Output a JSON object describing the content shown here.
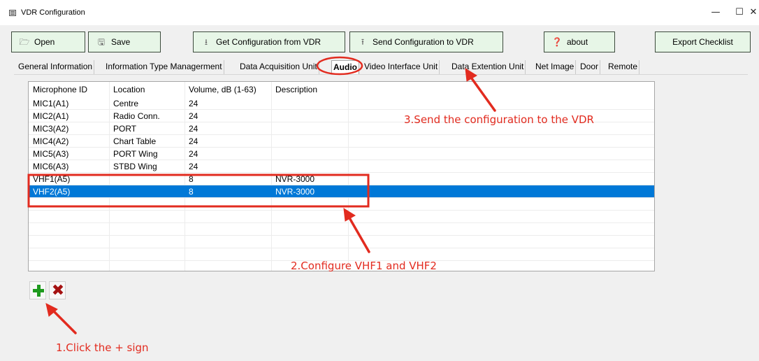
{
  "window": {
    "title": "VDR Configuration",
    "controls": {
      "minimize": "—",
      "maximize": "☐",
      "close": "✕"
    }
  },
  "toolbar": {
    "open_label": "Open",
    "open_icon": "folder-open-icon",
    "save_label": "Save",
    "save_icon": "floppy-disk-icon",
    "get_config_label": "Get Configuration from VDR",
    "get_config_icon": "download-tray-icon",
    "send_config_label": "Send Configuration to VDR",
    "send_config_icon": "upload-tray-icon",
    "about_label": "about",
    "about_icon": "question-circle-icon",
    "export_label": "Export Checklist"
  },
  "tabs": [
    {
      "label": "General Information"
    },
    {
      "label": "Information Type Managerment"
    },
    {
      "label": "Data Acquisition Unit"
    },
    {
      "label": "Audio",
      "active": true
    },
    {
      "label": "Video Interface Unit"
    },
    {
      "label": "Data Extention Unit"
    },
    {
      "label": "Net Image"
    },
    {
      "label": "Door"
    },
    {
      "label": "Remote"
    }
  ],
  "audio_table": {
    "columns": [
      "Microphone ID",
      "Location",
      "Volume, dB (1-63)",
      "Description"
    ],
    "rows": [
      [
        "MIC1(A1)",
        "Centre",
        "24",
        ""
      ],
      [
        "MIC2(A1)",
        "Radio Conn.",
        "24",
        ""
      ],
      [
        "MIC3(A2)",
        "PORT",
        "24",
        ""
      ],
      [
        "MIC4(A2)",
        "Chart Table",
        "24",
        ""
      ],
      [
        "MIC5(A3)",
        "PORT Wing",
        "24",
        ""
      ],
      [
        "MIC6(A3)",
        "STBD Wing",
        "24",
        ""
      ],
      [
        "VHF1(A5)",
        "",
        "8",
        "NVR-3000"
      ],
      [
        "VHF2(A5)",
        "",
        "8",
        "NVR-3000"
      ]
    ],
    "selected_row": 7
  },
  "row_actions": {
    "add_icon": "plus-icon",
    "delete_icon": "delete-x-icon",
    "delete_glyph": "✖"
  },
  "annotations": {
    "step1": "1.Click the + sign",
    "step2": "2.Configure VHF1 and VHF2",
    "step3": "3.Send the configuration to the VDR",
    "color": "#e22b1f"
  },
  "colors": {
    "button_bg": "#e7f6e7",
    "selection": "#0078d7"
  }
}
